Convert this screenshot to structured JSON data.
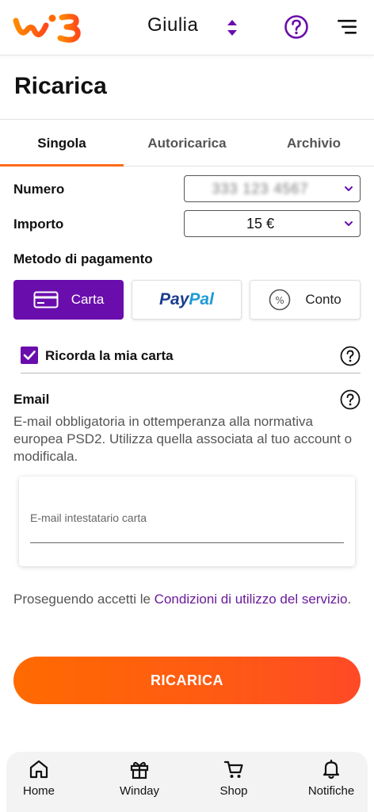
{
  "header": {
    "logo_icon": "windtre-logo-icon",
    "user_name": "Giulia",
    "switch_icon": "up-down-chevron-icon",
    "help_icon": "help-icon",
    "menu_icon": "menu-icon",
    "accent_color": "#6a0dad",
    "brand_color": "#ff6b1a"
  },
  "page": {
    "title": "Ricarica"
  },
  "tabs": [
    {
      "label": "Singola",
      "active": true
    },
    {
      "label": "Autoricarica",
      "active": false
    },
    {
      "label": "Archivio",
      "active": false
    }
  ],
  "form": {
    "numero": {
      "label": "Numero",
      "value": "333 123 4567"
    },
    "importo": {
      "label": "Importo",
      "value": "15 €"
    },
    "payment": {
      "label": "Metodo di pagamento",
      "options": [
        {
          "label": "Carta",
          "icon": "credit-card-icon",
          "selected": true
        },
        {
          "label": "PayPal",
          "icon": "paypal-logo",
          "selected": false
        },
        {
          "label": "Conto",
          "icon": "percent-icon",
          "selected": false
        }
      ]
    },
    "remember_card": {
      "label": "Ricorda la mia carta",
      "checked": true
    },
    "email": {
      "title": "Email",
      "description": "E-mail obbligatoria in ottemperanza alla normativa europea PSD2. Utilizza quella associata al tuo account o modificala.",
      "placeholder": "E-mail intestatario carta",
      "value": ""
    }
  },
  "terms": {
    "prefix": "Proseguendo accetti le ",
    "link": "Condizioni di utilizzo del servizio",
    "suffix": "."
  },
  "cta": {
    "label": "RICARICA"
  },
  "bottom_nav": [
    {
      "label": "Home",
      "icon": "home-icon"
    },
    {
      "label": "Winday",
      "icon": "gift-icon"
    },
    {
      "label": "Shop",
      "icon": "cart-icon"
    },
    {
      "label": "Notifiche",
      "icon": "bell-icon"
    }
  ]
}
